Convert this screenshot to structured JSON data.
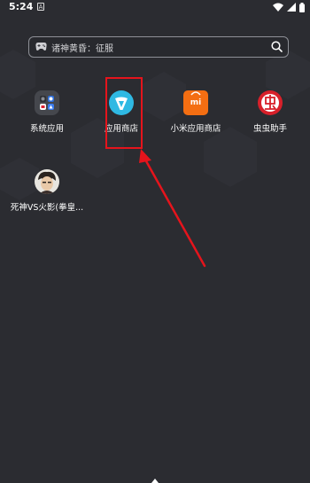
{
  "status_bar": {
    "time": "5:24",
    "notif_icon_glyph": "A"
  },
  "search": {
    "hint": "诸神黄昏：征服"
  },
  "apps": [
    {
      "label": "系统应用"
    },
    {
      "label": "应用商店"
    },
    {
      "label": "小米应用商店",
      "badge": "mi"
    },
    {
      "label": "虫虫助手"
    },
    {
      "label": "死神VS火影(拳皇..."
    }
  ],
  "colors": {
    "background": "#2b2c31",
    "annotation": "#e5141c",
    "store_icon": "#2fb9e3",
    "mi_icon": "#f46e12",
    "chong_icon": "#d8202a"
  }
}
